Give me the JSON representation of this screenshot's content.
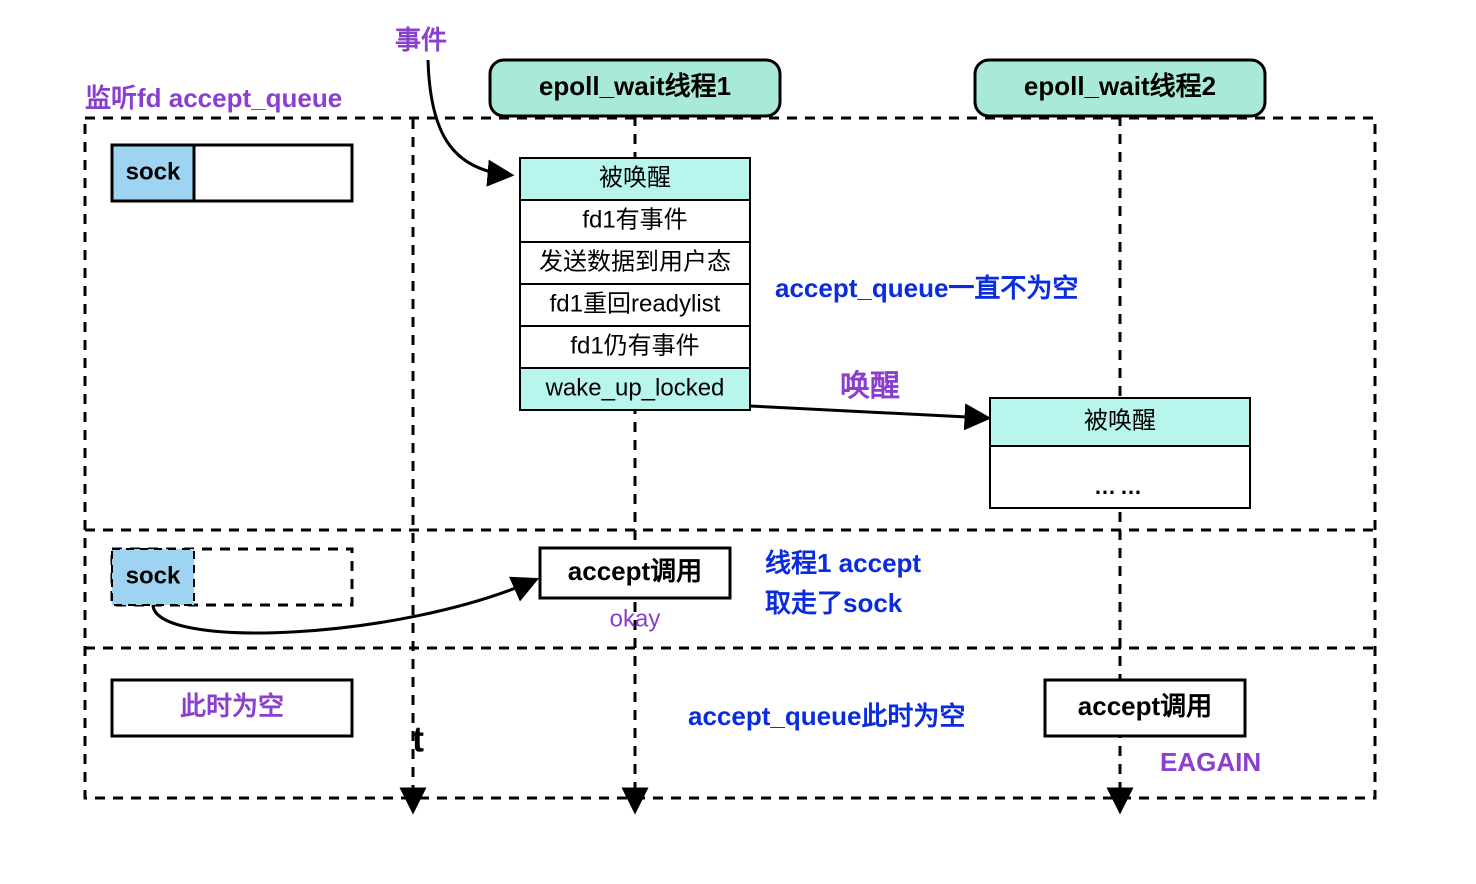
{
  "labels": {
    "event": "事件",
    "listen_title": "监听fd accept_queue",
    "thread1": "epoll_wait线程1",
    "thread2": "epoll_wait线程2",
    "sock": "sock",
    "t": "t",
    "steps1": {
      "wake": "被唤醒",
      "r1": "fd1有事件",
      "r2": "发送数据到用户态",
      "r3": "fd1重回readylist",
      "r4": "fd1仍有事件",
      "r5": "wake_up_locked"
    },
    "queue_nonempty": "accept_queue一直不为空",
    "wake_arrow": "唤醒",
    "steps2": {
      "wake": "被唤醒",
      "dots": "……"
    },
    "accept1": "accept调用",
    "okay": "okay",
    "thread1_accept_l1": "线程1 accept",
    "thread1_accept_l2": "取走了sock",
    "empty_now": "此时为空",
    "queue_empty": "accept_queue此时为空",
    "accept2": "accept调用",
    "eagain": "EAGAIN"
  }
}
